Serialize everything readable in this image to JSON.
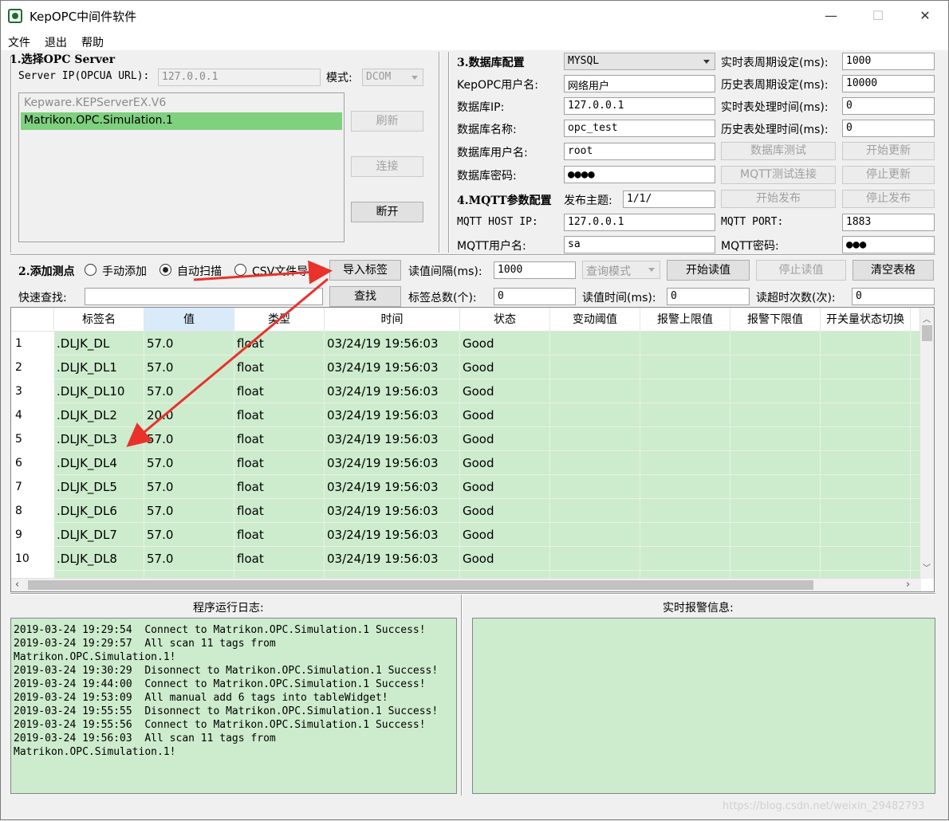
{
  "window": {
    "title": "KepOPC中间件软件",
    "min": "—",
    "max": "☐",
    "close": "✕"
  },
  "menu": [
    "文件",
    "退出",
    "帮助"
  ],
  "opc": {
    "section_title": "1.选择OPC Server",
    "server_ip_label": "Server IP(OPCUA URL):",
    "server_ip_value": "127.0.0.1",
    "mode_label": "模式:",
    "mode_value": "DCOM",
    "servers": [
      "Kepware.KEPServerEX.V6",
      "Matrikon.OPC.Simulation.1"
    ],
    "selected_index": 1,
    "refresh_label": "刷新",
    "connect_label": "连接",
    "disconnect_label": "断开"
  },
  "db": {
    "section_title": "3.数据库配置",
    "db_type": "MYSQL",
    "user_label": "KepOPC用户名:",
    "user_value": "网络用户",
    "ip_label": "数据库IP:",
    "ip_value": "127.0.0.1",
    "name_label": "数据库名称:",
    "name_value": "opc_test",
    "dbuser_label": "数据库用户名:",
    "dbuser_value": "root",
    "pwd_label": "数据库密码:",
    "pwd_value": "●●●●",
    "rt_period_label": "实时表周期设定(ms):",
    "rt_period_value": "1000",
    "hist_period_label": "历史表周期设定(ms):",
    "hist_period_value": "10000",
    "rt_proc_label": "实时表处理时间(ms):",
    "rt_proc_value": "0",
    "hist_proc_label": "历史表处理时间(ms):",
    "hist_proc_value": "0",
    "db_test_label": "数据库测试",
    "start_update_label": "开始更新",
    "mqtt_test_label": "MQTT测试连接",
    "stop_update_label": "停止更新"
  },
  "mqtt": {
    "section_title": "4.MQTT参数配置",
    "topic_label": "发布主题:",
    "topic_value": "1/1/",
    "start_publish_label": "开始发布",
    "stop_publish_label": "停止发布",
    "host_label": "MQTT HOST IP:",
    "host_value": "127.0.0.1",
    "port_label": "MQTT PORT:",
    "port_value": "1883",
    "user_label": "MQTT用户名:",
    "user_value": "sa",
    "pwd_label": "MQTT密码:",
    "pwd_value": "●●●"
  },
  "tags": {
    "section_title": "2.添加测点",
    "manual_label": "手动添加",
    "auto_label": "自动扫描",
    "csv_label": "CSV文件导入",
    "import_label": "导入标签",
    "interval_label": "读值间隔(ms):",
    "interval_value": "1000",
    "query_mode": "查询模式",
    "start_read_label": "开始读值",
    "stop_read_label": "停止读值",
    "clear_label": "清空表格",
    "search_label": "快速查找:",
    "search_value": "",
    "search_btn_label": "查找",
    "total_label": "标签总数(个):",
    "total_value": "0",
    "read_time_label": "读值时间(ms):",
    "read_time_value": "0",
    "timeout_label": "读超时次数(次):",
    "timeout_value": "0"
  },
  "table": {
    "columns": [
      "标签名",
      "值",
      "类型",
      "时间",
      "状态",
      "变动阈值",
      "报警上限值",
      "报警下限值",
      "开关量状态切换"
    ],
    "rows": [
      [
        "1",
        ".DLJK_DL",
        "57.0",
        "float",
        "03/24/19 19:56:03",
        "Good"
      ],
      [
        "2",
        ".DLJK_DL1",
        "57.0",
        "float",
        "03/24/19 19:56:03",
        "Good"
      ],
      [
        "3",
        ".DLJK_DL10",
        "57.0",
        "float",
        "03/24/19 19:56:03",
        "Good"
      ],
      [
        "4",
        ".DLJK_DL2",
        "20.0",
        "float",
        "03/24/19 19:56:03",
        "Good"
      ],
      [
        "5",
        ".DLJK_DL3",
        "57.0",
        "float",
        "03/24/19 19:56:03",
        "Good"
      ],
      [
        "6",
        ".DLJK_DL4",
        "57.0",
        "float",
        "03/24/19 19:56:03",
        "Good"
      ],
      [
        "7",
        ".DLJK_DL5",
        "57.0",
        "float",
        "03/24/19 19:56:03",
        "Good"
      ],
      [
        "8",
        ".DLJK_DL6",
        "57.0",
        "float",
        "03/24/19 19:56:03",
        "Good"
      ],
      [
        "9",
        ".DLJK_DL7",
        "57.0",
        "float",
        "03/24/19 19:56:03",
        "Good"
      ],
      [
        "10",
        ".DLJK_DL8",
        "57.0",
        "float",
        "03/24/19 19:56:03",
        "Good"
      ]
    ]
  },
  "log": {
    "title": "程序运行日志:",
    "lines": [
      "2019-03-24 19:29:54  Connect to Matrikon.OPC.Simulation.1 Success!",
      "2019-03-24 19:29:57  All scan 11 tags from",
      "Matrikon.OPC.Simulation.1!",
      "2019-03-24 19:30:29  Disonnect to Matrikon.OPC.Simulation.1 Success!",
      "2019-03-24 19:44:00  Connect to Matrikon.OPC.Simulation.1 Success!",
      "2019-03-24 19:53:09  All manual add 6 tags into tableWidget!",
      "2019-03-24 19:55:55  Disonnect to Matrikon.OPC.Simulation.1 Success!",
      "2019-03-24 19:55:56  Connect to Matrikon.OPC.Simulation.1 Success!",
      "2019-03-24 19:56:03  All scan 11 tags from",
      "Matrikon.OPC.Simulation.1!"
    ]
  },
  "alarm": {
    "title": "实时报警信息:"
  },
  "watermark": "https://blog.csdn.net/weixin_29482793",
  "colors": {
    "green_cell": "#cdebcd",
    "selected_item": "#7fd07f",
    "arrow": "#e8322b"
  }
}
